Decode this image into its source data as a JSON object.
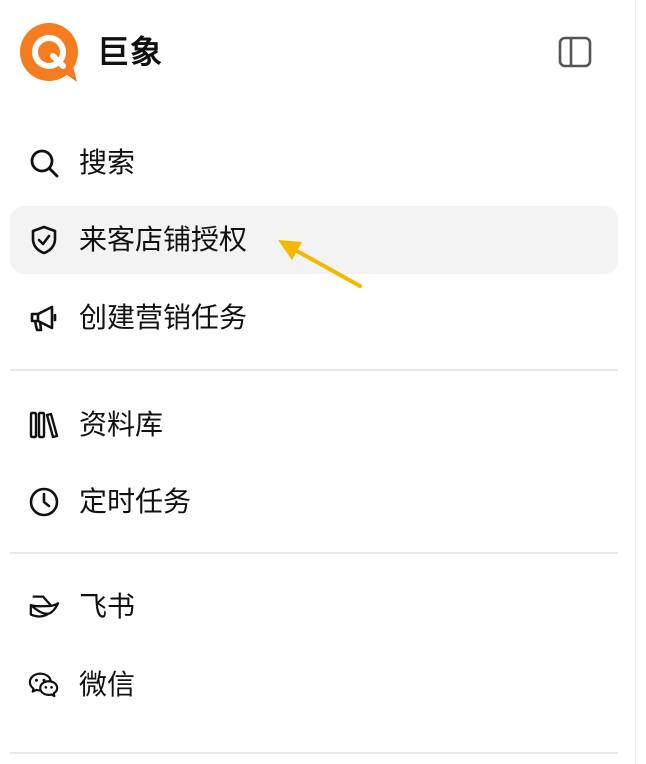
{
  "app": {
    "name": "巨象",
    "logo_letter": "Q",
    "logo_color": "#f57c1f"
  },
  "menu": {
    "search": "搜索",
    "store_auth": "来客店铺授权",
    "marketing_task": "创建营销任务",
    "library": "资料库",
    "scheduled_task": "定时任务",
    "feishu": "飞书",
    "wechat": "微信"
  },
  "colors": {
    "active_bg": "#f3f3f3",
    "arrow": "#f5b800",
    "divider": "#e8e8e8"
  }
}
